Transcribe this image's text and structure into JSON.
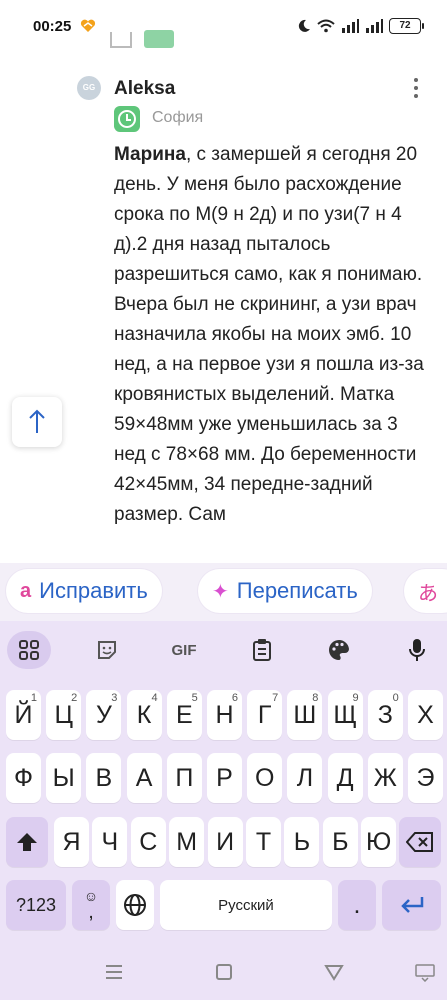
{
  "status_bar": {
    "time": "00:25",
    "battery": "72"
  },
  "comment": {
    "author": "Aleksa",
    "avatar_initials": "GG",
    "child_name": "София",
    "mention": "Марина",
    "text": ", с замершей я сегодня 20 день. У меня было расхождение срока по М(9 н 2д) и по узи(7 н 4 д).2 дня назад пыталось разрешиться само, как я понимаю. Вчера был не скрининг, а узи врач назначила якобы на моих эмб. 10 нед, а на первое узи я пошла из-за кровянистых выделений. Матка 59×48мм уже уменьшилась за 3 нед с 78×68 мм. До беременности 42×45мм, 34 передне-задний размер. Сам"
  },
  "suggestions": {
    "fix": "Исправить",
    "rewrite": "Переписать"
  },
  "keyboard": {
    "row1": [
      {
        "k": "Й",
        "n": "1"
      },
      {
        "k": "Ц",
        "n": "2"
      },
      {
        "k": "У",
        "n": "3"
      },
      {
        "k": "К",
        "n": "4"
      },
      {
        "k": "Е",
        "n": "5"
      },
      {
        "k": "Н",
        "n": "6"
      },
      {
        "k": "Г",
        "n": "7"
      },
      {
        "k": "Ш",
        "n": "8"
      },
      {
        "k": "Щ",
        "n": "9"
      },
      {
        "k": "З",
        "n": "0"
      },
      {
        "k": "Х",
        "n": ""
      }
    ],
    "row2": [
      "Ф",
      "Ы",
      "В",
      "А",
      "П",
      "Р",
      "О",
      "Л",
      "Д",
      "Ж",
      "Э"
    ],
    "row3": [
      "Я",
      "Ч",
      "С",
      "М",
      "И",
      "Т",
      "Ь",
      "Б",
      "Ю"
    ],
    "numbers_key": "?123",
    "comma": ",",
    "space_label": "Русский",
    "period": "."
  },
  "colors": {
    "accent": "#2b64c6",
    "keyboard_bg": "#ece3f7",
    "func_key": "#dccdf0",
    "badge_green": "#5ec67a"
  }
}
